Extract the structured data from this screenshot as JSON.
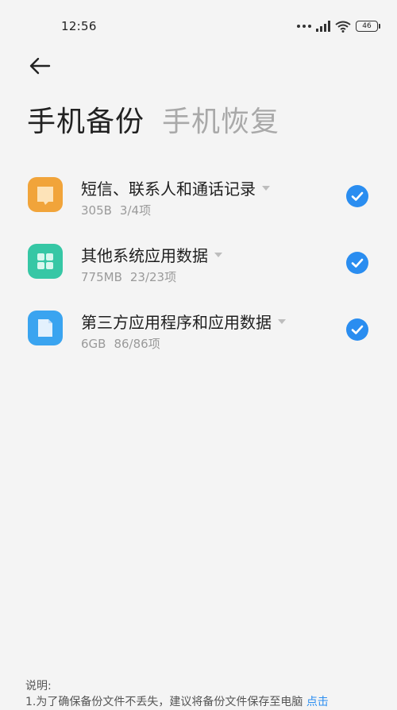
{
  "status_bar": {
    "time": "12:56",
    "battery": "46",
    "icons": [
      "more-dots-icon",
      "signal-icon",
      "wifi-icon",
      "battery-icon"
    ]
  },
  "header": {
    "back_icon": "back-arrow-icon",
    "tabs": [
      {
        "label": "手机备份",
        "active": true
      },
      {
        "label": "手机恢复",
        "active": false
      }
    ]
  },
  "items": [
    {
      "title": "短信、联系人和通话记录",
      "size": "305B",
      "count": "3/4项",
      "icon": "messages-icon",
      "color": "#f1a43a",
      "checked": true
    },
    {
      "title": "其他系统应用数据",
      "size": "775MB",
      "count": "23/23项",
      "icon": "apps-grid-icon",
      "color": "#36c7a5",
      "checked": true
    },
    {
      "title": "第三方应用程序和应用数据",
      "size": "6GB",
      "count": "86/86项",
      "icon": "file-icon",
      "color": "#3aa4f0",
      "checked": true
    }
  ],
  "footer": {
    "label": "说明:",
    "text": "1.为了确保备份文件不丢失，建议将备份文件保存至电脑",
    "link": "点击"
  },
  "colors": {
    "accent": "#2a8df0",
    "background": "#f4f4f4"
  }
}
